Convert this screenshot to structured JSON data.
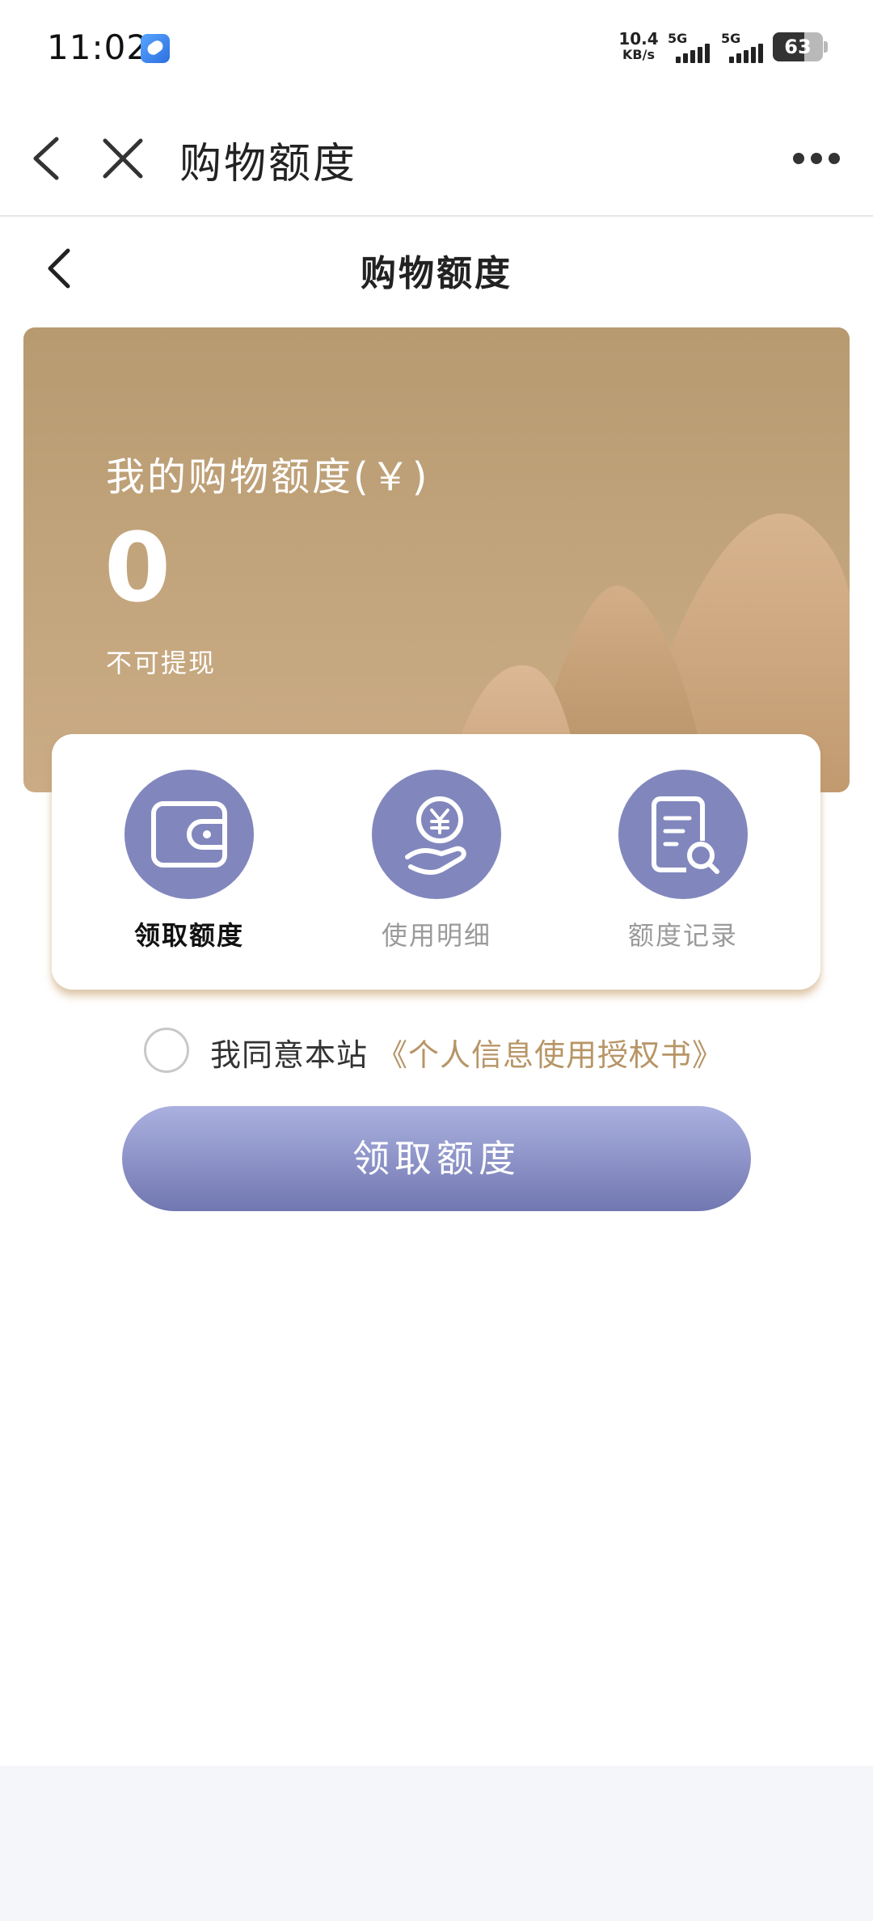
{
  "status_bar": {
    "time": "11:02",
    "net_speed_value": "10.4",
    "net_speed_unit": "KB/s",
    "signal1_label": "5G",
    "signal2_label": "5G",
    "battery": "63"
  },
  "topnav": {
    "title": "购物额度",
    "icons": [
      "back-arrow-icon",
      "close-icon",
      "more-icon"
    ]
  },
  "subheader": {
    "title": "购物额度"
  },
  "hero": {
    "label": "我的购物额度(￥)",
    "amount": "0",
    "note": "不可提现",
    "colors": {
      "bg": "#b79a70"
    }
  },
  "actions": [
    {
      "label": "领取额度",
      "icon": "wallet-icon",
      "active": true
    },
    {
      "label": "使用明细",
      "icon": "yuan-hand-icon",
      "active": false
    },
    {
      "label": "额度记录",
      "icon": "document-search-icon",
      "active": false
    }
  ],
  "agreement": {
    "text": "我同意本站",
    "link": "《个人信息使用授权书》"
  },
  "primary_button": {
    "label": "领取额度"
  },
  "colors": {
    "accent": "#8187bd",
    "link": "#b79566"
  }
}
